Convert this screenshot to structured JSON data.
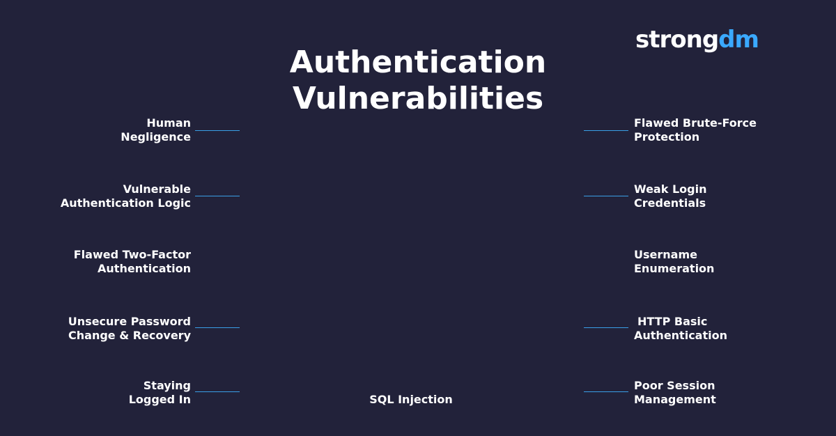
{
  "logo": {
    "part1": "strong",
    "part2": "dm"
  },
  "title": {
    "line1": "Authentication",
    "line2": "Vulnerabilities"
  },
  "left_items": [
    {
      "line1": "Human",
      "line2": "Negligence"
    },
    {
      "line1": "Vulnerable",
      "line2": "Authentication Logic"
    },
    {
      "line1": "Flawed Two-Factor",
      "line2": "Authentication"
    },
    {
      "line1": "Unsecure Password",
      "line2": "Change & Recovery"
    },
    {
      "line1": "Staying",
      "line2": "Logged In"
    }
  ],
  "right_items": [
    {
      "line1": "Flawed Brute-Force",
      "line2": "Protection"
    },
    {
      "line1": "Weak Login",
      "line2": "Credentials"
    },
    {
      "line1": "Username",
      "line2": "Enumeration"
    },
    {
      "line1": "HTTP Basic",
      "line2": "Authentication"
    },
    {
      "line1": "Poor Session",
      "line2": "Management"
    }
  ],
  "bottom_item": "SQL Injection",
  "colors": {
    "background": "#22223a",
    "accent": "#3aa0e8",
    "text": "#ffffff"
  }
}
